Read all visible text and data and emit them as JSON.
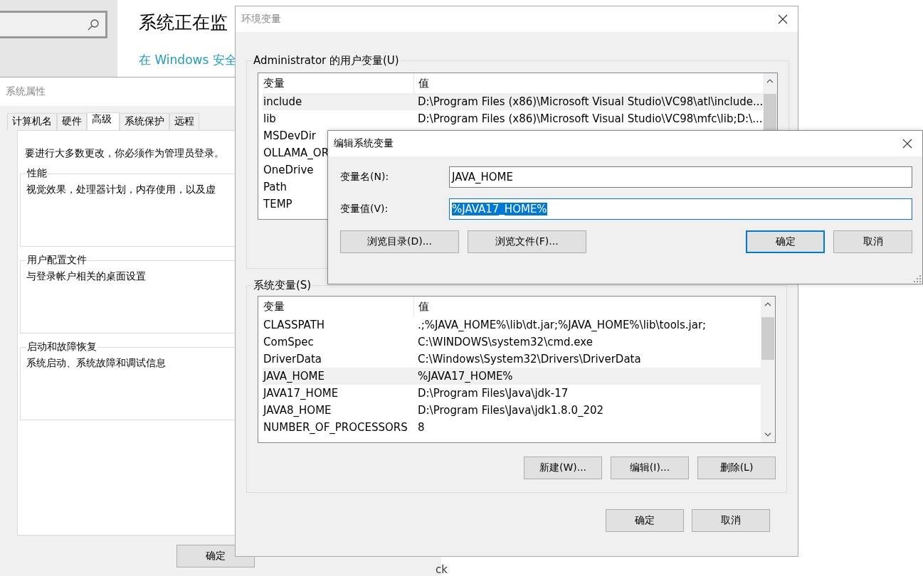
{
  "settings_background": {
    "title": "系统正在监",
    "link": "在 Windows 安全"
  },
  "system_properties": {
    "title": "系统属性",
    "tabs": [
      {
        "label": "计算机名",
        "selected": false
      },
      {
        "label": "硬件",
        "selected": false
      },
      {
        "label": "高级",
        "selected": true
      },
      {
        "label": "系统保护",
        "selected": false
      },
      {
        "label": "远程",
        "selected": false
      }
    ],
    "notice": "要进行大多数更改，你必须作为管理员登录。",
    "groups": [
      {
        "title": "性能",
        "description": "视觉效果，处理器计划，内存使用，以及虚"
      },
      {
        "title": "用户配置文件",
        "description": "与登录帐户相关的桌面设置"
      },
      {
        "title": "启动和故障恢复",
        "description": "系统启动、系统故障和调试信息"
      }
    ],
    "buttons": [
      "确定"
    ]
  },
  "environment_variables": {
    "title": "环境变量",
    "user_group": {
      "title": "Administrator 的用户变量(U)",
      "columns": [
        "变量",
        "值"
      ],
      "rows": [
        {
          "name": "include",
          "value": "D:\\Program Files (x86)\\Microsoft Visual Studio\\VC98\\atl\\include...",
          "selected": true
        },
        {
          "name": "lib",
          "value": "D:\\Program Files (x86)\\Microsoft Visual Studio\\VC98\\mfc\\lib;D:\\...",
          "selected": false
        },
        {
          "name": "MSDevDir",
          "selected": false
        },
        {
          "name": "OLLAMA_OR",
          "selected": false
        },
        {
          "name": "OneDrive",
          "selected": false
        },
        {
          "name": "Path",
          "selected": false
        },
        {
          "name": "TEMP",
          "selected": false
        }
      ]
    },
    "system_group": {
      "title": "系统变量(S)",
      "columns": [
        "变量",
        "值"
      ],
      "rows": [
        {
          "name": "CLASSPATH",
          "value": ".;%JAVA_HOME%\\lib\\dt.jar;%JAVA_HOME%\\lib\\tools.jar;",
          "selected": false
        },
        {
          "name": "ComSpec",
          "value": "C:\\WINDOWS\\system32\\cmd.exe",
          "selected": false
        },
        {
          "name": "DriverData",
          "value": "C:\\Windows\\System32\\Drivers\\DriverData",
          "selected": false
        },
        {
          "name": "JAVA_HOME",
          "value": "%JAVA17_HOME%",
          "selected": true
        },
        {
          "name": "JAVA17_HOME",
          "value": "D:\\Program Files\\Java\\jdk-17",
          "selected": false
        },
        {
          "name": "JAVA8_HOME",
          "value": "D:\\Program Files\\Java\\jdk1.8.0_202",
          "selected": false
        },
        {
          "name": "NUMBER_OF_PROCESSORS",
          "value": "8",
          "selected": false
        }
      ],
      "buttons": [
        "新建(W)...",
        "编辑(I)...",
        "删除(L)"
      ]
    },
    "buttons": [
      "确定",
      "取消"
    ]
  },
  "edit_dialog": {
    "title": "编辑系统变量",
    "fields": [
      {
        "label": "变量名(N):",
        "value": "JAVA_HOME",
        "text_selected": false
      },
      {
        "label": "变量值(V):",
        "value": "%JAVA17_HOME%",
        "text_selected": true
      }
    ],
    "buttons": [
      {
        "label": "浏览目录(D)...",
        "default": false
      },
      {
        "label": "浏览文件(F)...",
        "default": false
      },
      {
        "label": "确定",
        "default": true
      },
      {
        "label": "取消",
        "default": false
      }
    ]
  },
  "background_fragment": "ck"
}
